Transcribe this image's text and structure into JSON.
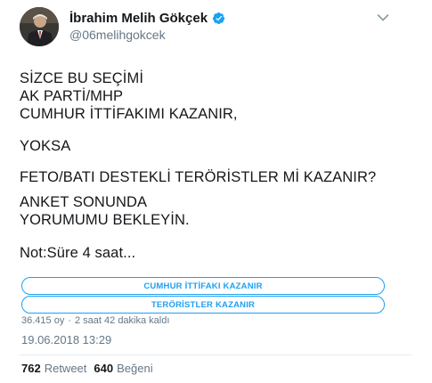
{
  "author": {
    "name": "İbrahim Melih Gökçek",
    "handle": "@06melihgokcek",
    "verified": true,
    "icon": "verified-badge-icon"
  },
  "tweet": {
    "paragraphs": [
      "SİZCE BU SEÇİMİ\nAK PARTİ/MHP\nCUMHUR İTTİFAKIMI KAZANIR,",
      "YOKSA",
      "FETO/BATI DESTEKLİ TERÖRİSTLER Mİ KAZANIR?",
      "ANKET SONUNDA\nYORUMUMU BEKLEYİN.",
      "Not:Süre 4 saat..."
    ]
  },
  "poll": {
    "options": [
      "CUMHUR İTTİFAKI KAZANIR",
      "TERÖRİSTLER KAZANIR"
    ],
    "votes": "36.415 oy",
    "separator": "·",
    "time_left": "2 saat 42 dakika kaldı"
  },
  "timestamp": "19.06.2018 13:29",
  "stats": {
    "retweets": "762",
    "retweets_label": "Retweet",
    "likes": "640",
    "likes_label": "Beğeni"
  },
  "colors": {
    "accent": "#1da1f2",
    "text": "#14171a",
    "muted": "#657786"
  }
}
